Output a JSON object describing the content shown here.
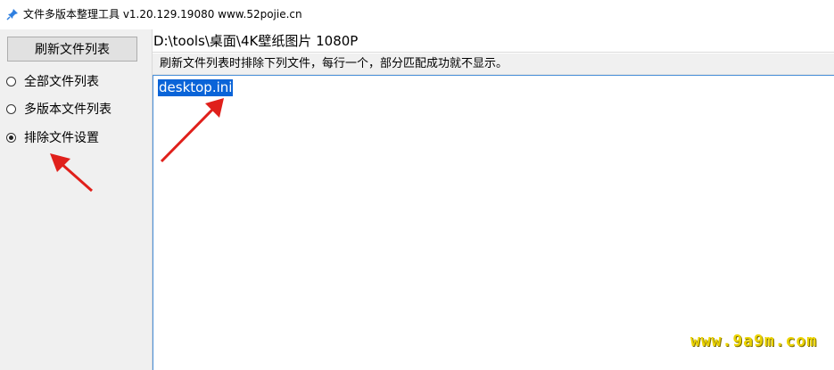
{
  "window": {
    "title": "文件多版本整理工具 v1.20.129.19080 www.52pojie.cn",
    "icon": "pin-icon"
  },
  "sidebar": {
    "refresh_button": "刷新文件列表",
    "options": [
      {
        "label": "全部文件列表",
        "checked": false
      },
      {
        "label": "多版本文件列表",
        "checked": false
      },
      {
        "label": "排除文件设置",
        "checked": true
      }
    ]
  },
  "main": {
    "path": "D:\\tools\\桌面\\4K壁纸图片 1080P",
    "hint": "刷新文件列表时排除下列文件，每行一个，部分匹配成功就不显示。",
    "exclude_entries": [
      "desktop.ini"
    ]
  },
  "watermark": "www.9a9m.com",
  "colors": {
    "annotation_arrow": "#e0201b",
    "selection": "#0a64d8",
    "watermark": "#ecd400"
  }
}
